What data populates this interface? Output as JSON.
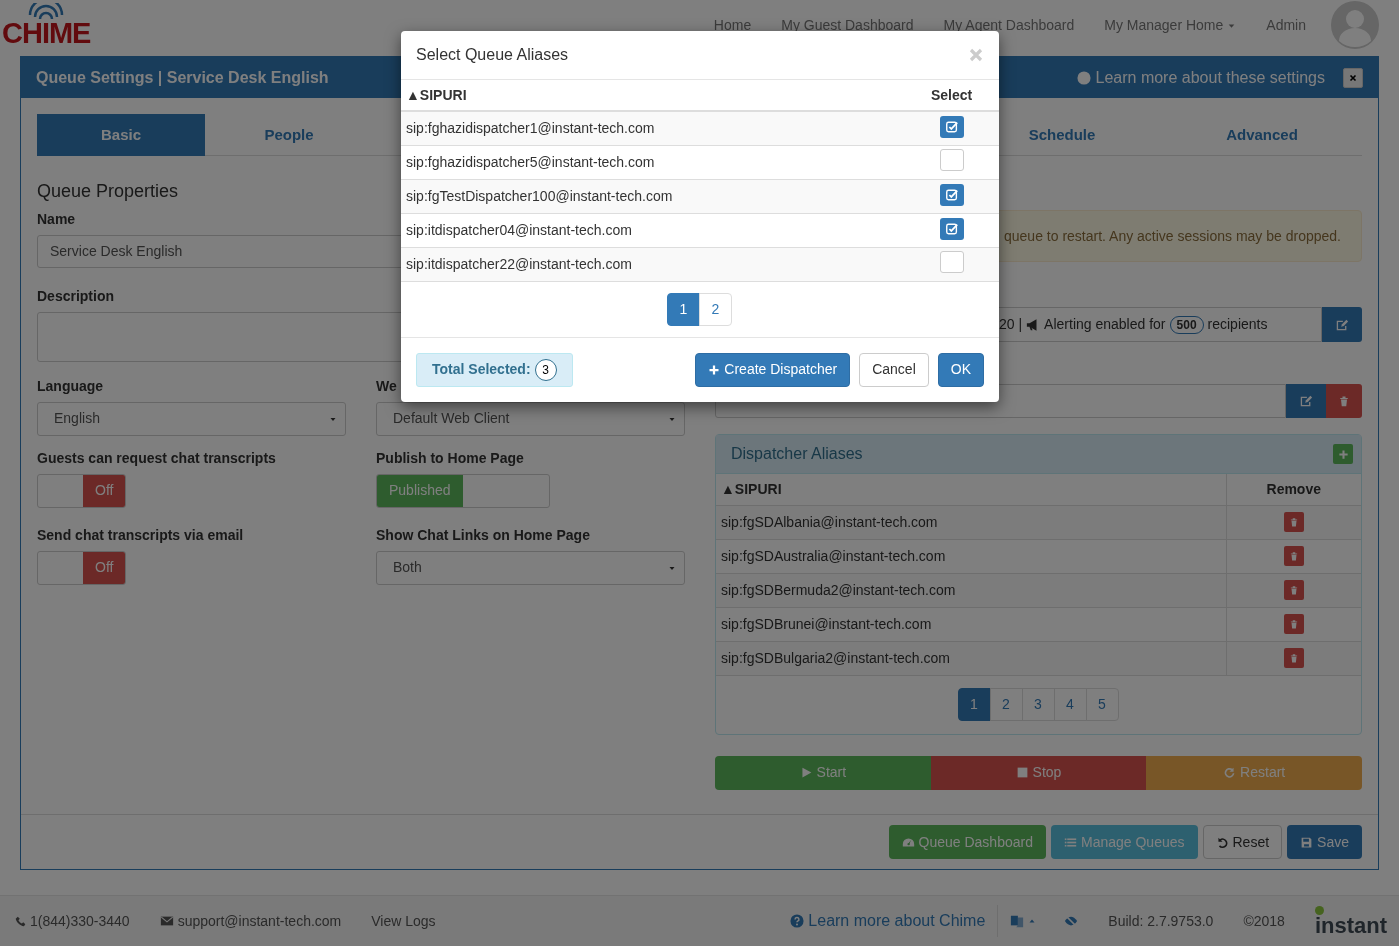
{
  "navbar": {
    "logo": "CHIME",
    "links": [
      {
        "label": "Home",
        "dropdown": false
      },
      {
        "label": "My Guest Dashboard",
        "dropdown": false
      },
      {
        "label": "My Agent Dashboard",
        "dropdown": false
      },
      {
        "label": "My Manager Home",
        "dropdown": true
      },
      {
        "label": "Admin",
        "dropdown": false
      }
    ]
  },
  "panel": {
    "title": "Queue Settings | Service Desk English",
    "help_link": "Learn more about these settings",
    "tabs": [
      {
        "label": "Basic",
        "selected": true
      },
      {
        "label": "People",
        "selected": false
      },
      {
        "label": "Schedule",
        "selected": false
      },
      {
        "label": "Advanced",
        "selected": false
      }
    ],
    "section_title": "Queue Properties",
    "name_field": {
      "label": "Name",
      "value": "Service Desk English"
    },
    "description_field": {
      "label": "Description"
    },
    "form_items": [
      {
        "kind": "select",
        "label": "Language",
        "value": "English"
      },
      {
        "kind": "select",
        "label": "We",
        "value": "Default Web Client"
      },
      {
        "kind": "toggle",
        "label": "Guests can request chat transcripts",
        "on": false,
        "state_text": "Off"
      },
      {
        "kind": "toggle",
        "label": "Publish to Home Page",
        "on": true,
        "state_text": "Published"
      },
      {
        "kind": "toggle",
        "label": "Send chat transcripts via email",
        "on": false,
        "state_text": "Off"
      },
      {
        "kind": "select",
        "label": "Show Chat Links on Home Page",
        "value": "Both"
      }
    ],
    "alert_text": "queue to restart. Any active sessions may be dropped.",
    "alerting": {
      "prefix": "20 |",
      "text": "Alerting enabled for",
      "count": "500",
      "suffix": "recipients"
    },
    "dispatcher_aliases": {
      "title": "Dispatcher Aliases",
      "columns": [
        "▲SIPURI",
        "Remove"
      ],
      "rows": [
        "sip:fgSDAlbania@instant-tech.com",
        "sip:fgSDAustralia@instant-tech.com",
        "sip:fgSDBermuda2@instant-tech.com",
        "sip:fgSDBrunei@instant-tech.com",
        "sip:fgSDBulgaria2@instant-tech.com"
      ],
      "pages": [
        {
          "label": "1",
          "selected": true
        },
        {
          "label": "2",
          "selected": false
        },
        {
          "label": "3",
          "selected": false
        },
        {
          "label": "4",
          "selected": false
        },
        {
          "label": "5",
          "selected": false
        }
      ]
    },
    "controls": [
      {
        "kind": "start",
        "label": "Start"
      },
      {
        "kind": "stop",
        "label": "Stop"
      },
      {
        "kind": "restart",
        "label": "Restart"
      }
    ],
    "actions": [
      {
        "kind": "dashboard",
        "label": "Queue Dashboard"
      },
      {
        "kind": "manage",
        "label": "Manage Queues"
      },
      {
        "kind": "reset",
        "label": "Reset"
      },
      {
        "kind": "save",
        "label": "Save"
      }
    ]
  },
  "footer": {
    "phone": "1(844)330-3440",
    "email": "support@instant-tech.com",
    "logs": "View Logs",
    "help": "Learn more about Chime",
    "build": "Build: 2.7.9753.0",
    "copyright": "©2018",
    "brand": "instant"
  },
  "modal": {
    "title": "Select Queue Aliases",
    "columns": [
      "▲SIPURI",
      "Select"
    ],
    "rows": [
      {
        "sip": "sip:fghazidispatcher1@instant-tech.com",
        "checked": true
      },
      {
        "sip": "sip:fghazidispatcher5@instant-tech.com",
        "checked": false
      },
      {
        "sip": "sip:fgTestDispatcher100@instant-tech.com",
        "checked": true
      },
      {
        "sip": "sip:itdispatcher04@instant-tech.com",
        "checked": true
      },
      {
        "sip": "sip:itdispatcher22@instant-tech.com",
        "checked": false
      }
    ],
    "pages": [
      {
        "label": "1",
        "selected": true
      },
      {
        "label": "2",
        "selected": false
      }
    ],
    "total_label": "Total Selected:",
    "total": "3",
    "buttons": [
      {
        "kind": "create",
        "label": "Create Dispatcher"
      },
      {
        "kind": "cancel",
        "label": "Cancel"
      },
      {
        "kind": "ok",
        "label": "OK"
      }
    ]
  }
}
